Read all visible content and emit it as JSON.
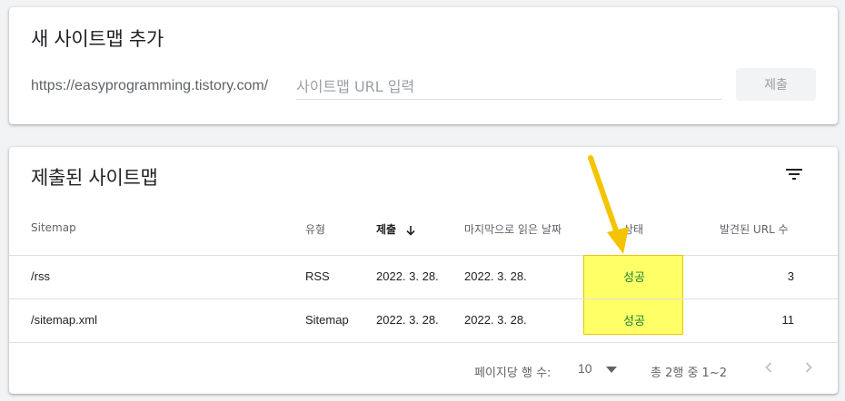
{
  "add_sitemap": {
    "title": "새 사이트맵 추가",
    "url_prefix": "https://easyprogramming.tistory.com/",
    "input_placeholder": "사이트맵 URL 입력",
    "submit_label": "제출"
  },
  "submitted": {
    "title": "제출된 사이트맵",
    "columns": {
      "sitemap": "Sitemap",
      "type": "유형",
      "submitted": "제출",
      "last_read": "마지막으로 읽은 날짜",
      "status": "상태",
      "discovered": "발견된 URL 수"
    },
    "rows": [
      {
        "sitemap": "/rss",
        "type": "RSS",
        "submitted": "2022. 3. 28.",
        "last_read": "2022. 3. 28.",
        "status": "성공",
        "discovered": "3"
      },
      {
        "sitemap": "/sitemap.xml",
        "type": "Sitemap",
        "submitted": "2022. 3. 28.",
        "last_read": "2022. 3. 28.",
        "status": "성공",
        "discovered": "11"
      }
    ],
    "footer": {
      "rows_per_page_label": "페이지당 행 수:",
      "rows_per_page_value": "10",
      "range_text": "총 2행 중 1~2"
    }
  },
  "icons": {
    "filter": "filter-icon",
    "sort": "arrow-down-icon",
    "dropdown": "dropdown-icon",
    "prev": "chevron-left-icon",
    "next": "chevron-right-icon"
  },
  "colors": {
    "status_success": "#188038",
    "highlight": "#ffff66",
    "annotation_arrow": "#f5c400"
  }
}
